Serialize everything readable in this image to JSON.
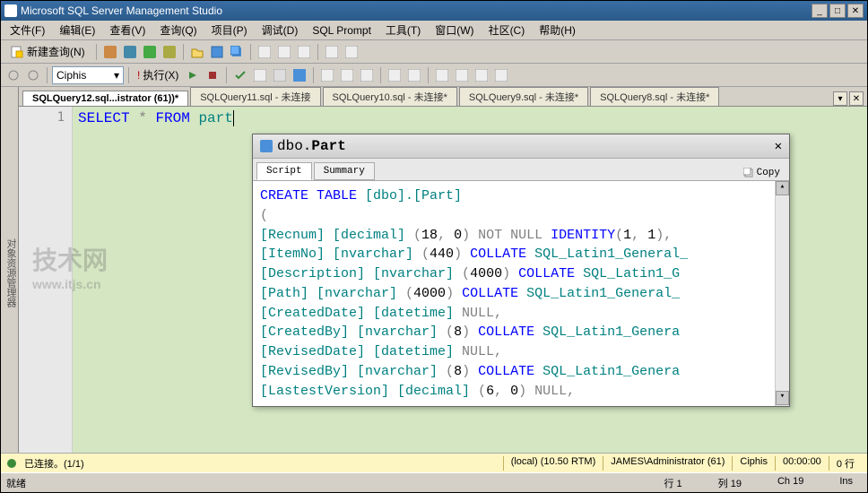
{
  "window": {
    "title": "Microsoft SQL Server Management Studio"
  },
  "menu": [
    "文件(F)",
    "编辑(E)",
    "查看(V)",
    "查询(Q)",
    "项目(P)",
    "调试(D)",
    "SQL Prompt",
    "工具(T)",
    "窗口(W)",
    "社区(C)",
    "帮助(H)"
  ],
  "toolbar1": {
    "newquery": "新建查询(N)"
  },
  "toolbar2": {
    "db": "Ciphis",
    "execute": "执行(X)"
  },
  "tabs": [
    {
      "label": "SQLQuery12.sql...istrator (61))*",
      "active": true
    },
    {
      "label": "SQLQuery11.sql - 未连接",
      "active": false
    },
    {
      "label": "SQLQuery10.sql - 未连接*",
      "active": false
    },
    {
      "label": "SQLQuery9.sql - 未连接*",
      "active": false
    },
    {
      "label": "SQLQuery8.sql - 未连接*",
      "active": false
    }
  ],
  "editor": {
    "lineNo": "1",
    "kw1": "SELECT",
    "op": "*",
    "kw2": "FROM",
    "ident": "part"
  },
  "popup": {
    "title_prefix": "dbo.",
    "title_name": "Part",
    "tabs": {
      "script": "Script",
      "summary": "Summary"
    },
    "copy": "Copy",
    "lines": [
      [
        {
          "t": "CREATE TABLE",
          "c": "blue"
        },
        {
          "t": " [dbo].[Part]",
          "c": "teal"
        }
      ],
      [
        {
          "t": "(",
          "c": "gray"
        }
      ],
      [
        {
          "t": "[Recnum] [decimal] ",
          "c": "teal"
        },
        {
          "t": "(",
          "c": "gray"
        },
        {
          "t": "18",
          "c": "black"
        },
        {
          "t": ", ",
          "c": "gray"
        },
        {
          "t": "0",
          "c": "black"
        },
        {
          "t": ") NOT NULL ",
          "c": "gray"
        },
        {
          "t": "IDENTITY",
          "c": "blue"
        },
        {
          "t": "(",
          "c": "gray"
        },
        {
          "t": "1",
          "c": "black"
        },
        {
          "t": ", ",
          "c": "gray"
        },
        {
          "t": "1",
          "c": "black"
        },
        {
          "t": "),",
          "c": "gray"
        }
      ],
      [
        {
          "t": "[ItemNo] [nvarchar] ",
          "c": "teal"
        },
        {
          "t": "(",
          "c": "gray"
        },
        {
          "t": "440",
          "c": "black"
        },
        {
          "t": ") ",
          "c": "gray"
        },
        {
          "t": "COLLATE",
          "c": "blue"
        },
        {
          "t": " SQL_Latin1_General_",
          "c": "teal"
        }
      ],
      [
        {
          "t": "[Description] [nvarchar] ",
          "c": "teal"
        },
        {
          "t": "(",
          "c": "gray"
        },
        {
          "t": "4000",
          "c": "black"
        },
        {
          "t": ") ",
          "c": "gray"
        },
        {
          "t": "COLLATE",
          "c": "blue"
        },
        {
          "t": " SQL_Latin1_G",
          "c": "teal"
        }
      ],
      [
        {
          "t": "[Path] [nvarchar] ",
          "c": "teal"
        },
        {
          "t": "(",
          "c": "gray"
        },
        {
          "t": "4000",
          "c": "black"
        },
        {
          "t": ") ",
          "c": "gray"
        },
        {
          "t": "COLLATE",
          "c": "blue"
        },
        {
          "t": " SQL_Latin1_General_",
          "c": "teal"
        }
      ],
      [
        {
          "t": "[CreatedDate] [datetime] ",
          "c": "teal"
        },
        {
          "t": "NULL,",
          "c": "gray"
        }
      ],
      [
        {
          "t": "[CreatedBy] [nvarchar] ",
          "c": "teal"
        },
        {
          "t": "(",
          "c": "gray"
        },
        {
          "t": "8",
          "c": "black"
        },
        {
          "t": ") ",
          "c": "gray"
        },
        {
          "t": "COLLATE",
          "c": "blue"
        },
        {
          "t": " SQL_Latin1_Genera",
          "c": "teal"
        }
      ],
      [
        {
          "t": "[RevisedDate] [datetime] ",
          "c": "teal"
        },
        {
          "t": "NULL,",
          "c": "gray"
        }
      ],
      [
        {
          "t": "[RevisedBy] [nvarchar] ",
          "c": "teal"
        },
        {
          "t": "(",
          "c": "gray"
        },
        {
          "t": "8",
          "c": "black"
        },
        {
          "t": ") ",
          "c": "gray"
        },
        {
          "t": "COLLATE",
          "c": "blue"
        },
        {
          "t": " SQL_Latin1_Genera",
          "c": "teal"
        }
      ],
      [
        {
          "t": "[LastestVersion] [decimal] ",
          "c": "teal"
        },
        {
          "t": "(",
          "c": "gray"
        },
        {
          "t": "6",
          "c": "black"
        },
        {
          "t": ", ",
          "c": "gray"
        },
        {
          "t": "0",
          "c": "black"
        },
        {
          "t": ") NULL,",
          "c": "gray"
        }
      ]
    ]
  },
  "status_top": {
    "connected": "已连接。(1/1)",
    "cells": [
      "(local) (10.50 RTM)",
      "JAMES\\Administrator (61)",
      "Ciphis",
      "00:00:00",
      "0 行"
    ]
  },
  "status_bot": {
    "ready": "就绪",
    "line": "行 1",
    "col": "列 19",
    "ch": "Ch 19",
    "ins": "Ins"
  },
  "watermark": {
    "main": "技术网",
    "sub": "www.itjs.cn"
  }
}
